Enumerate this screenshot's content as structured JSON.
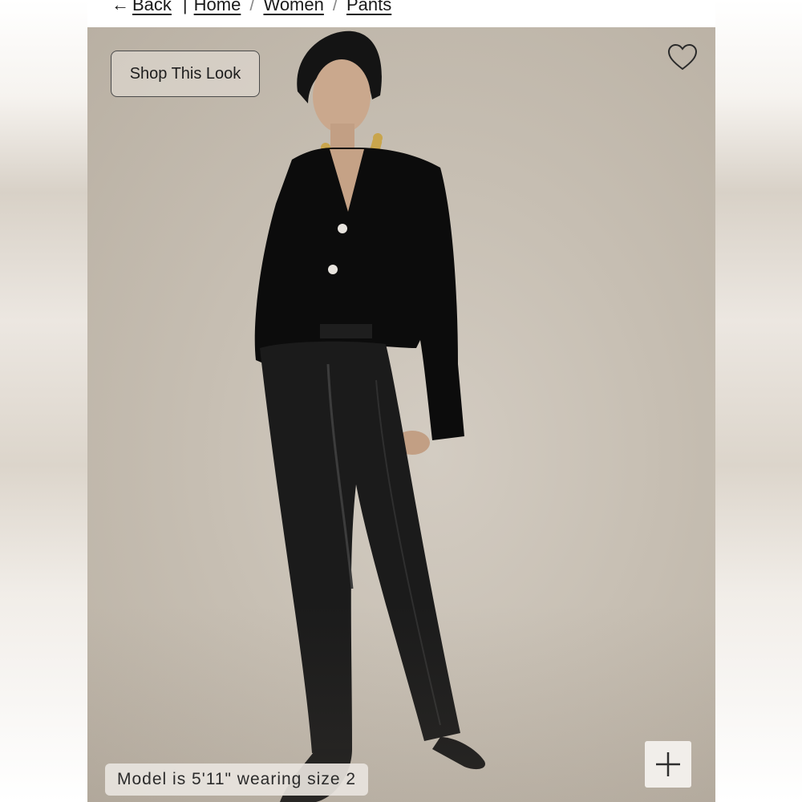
{
  "breadcrumb": {
    "back_label": "Back",
    "items": [
      "Home",
      "Women",
      "Pants"
    ],
    "separator": "/"
  },
  "photo": {
    "shop_look_label": "Shop This Look",
    "model_note": "Model is 5'11\" wearing size 2",
    "background_color": "#c9c1b6"
  },
  "icons": {
    "back": "arrow-left-icon",
    "favorite": "heart-icon",
    "expand": "plus-icon"
  }
}
